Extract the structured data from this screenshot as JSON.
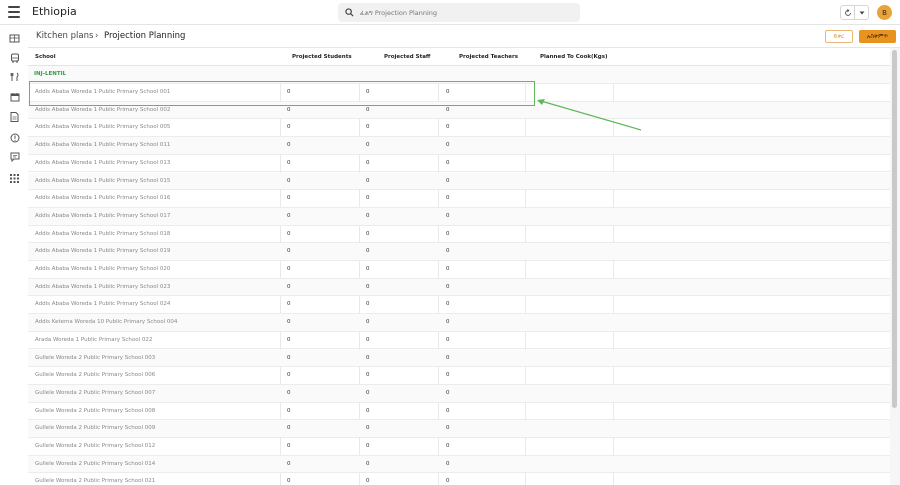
{
  "app": {
    "title": "Ethiopia",
    "avatar_initial": "B"
  },
  "search": {
    "placeholder": "ፈልግ Projection Planning"
  },
  "breadcrumb": {
    "root": "Kitchen plans",
    "separator": "›",
    "current": "Projection Planning"
  },
  "actions": {
    "edit_label": "ይቀር",
    "submit_label": "አስቀምጥ"
  },
  "sidebar": {
    "icons": [
      "kitchen-icon",
      "bus-icon",
      "fork-knife-icon",
      "calendar-icon",
      "document-icon",
      "info-icon",
      "chat-icon",
      "apps-grid-icon"
    ]
  },
  "table": {
    "columns": [
      "School",
      "Projected Students",
      "Projected Staff",
      "Projected Teachers",
      "Planned To Cook(Kgs)"
    ],
    "group": "INJ-LENTIL",
    "rows": [
      {
        "school": "Addis Ababa Woreda 1 Public Primary School 001",
        "students": "0",
        "staff": "0",
        "teachers": "0"
      },
      {
        "school": "Addis Ababa Woreda 1 Public Primary School 002",
        "students": "0",
        "staff": "0",
        "teachers": "0"
      },
      {
        "school": "Addis Ababa Woreda 1 Public Primary School 005",
        "students": "0",
        "staff": "0",
        "teachers": "0"
      },
      {
        "school": "Addis Ababa Woreda 1 Public Primary School 011",
        "students": "0",
        "staff": "0",
        "teachers": "0"
      },
      {
        "school": "Addis Ababa Woreda 1 Public Primary School 013",
        "students": "0",
        "staff": "0",
        "teachers": "0"
      },
      {
        "school": "Addis Ababa Woreda 1 Public Primary School 015",
        "students": "0",
        "staff": "0",
        "teachers": "0"
      },
      {
        "school": "Addis Ababa Woreda 1 Public Primary School 016",
        "students": "0",
        "staff": "0",
        "teachers": "0"
      },
      {
        "school": "Addis Ababa Woreda 1 Public Primary School 017",
        "students": "0",
        "staff": "0",
        "teachers": "0"
      },
      {
        "school": "Addis Ababa Woreda 1 Public Primary School 018",
        "students": "0",
        "staff": "0",
        "teachers": "0"
      },
      {
        "school": "Addis Ababa Woreda 1 Public Primary School 019",
        "students": "0",
        "staff": "0",
        "teachers": "0"
      },
      {
        "school": "Addis Ababa Woreda 1 Public Primary School 020",
        "students": "0",
        "staff": "0",
        "teachers": "0"
      },
      {
        "school": "Addis Ababa Woreda 1 Public Primary School 023",
        "students": "0",
        "staff": "0",
        "teachers": "0"
      },
      {
        "school": "Addis Ababa Woreda 1 Public Primary School 024",
        "students": "0",
        "staff": "0",
        "teachers": "0"
      },
      {
        "school": "Addis Ketema Woreda 10 Public Primary School 004",
        "students": "0",
        "staff": "0",
        "teachers": "0"
      },
      {
        "school": "Arada Woreda 1 Public Primary School 022",
        "students": "0",
        "staff": "0",
        "teachers": "0"
      },
      {
        "school": "Gullele Woreda 2 Public Primary School 003",
        "students": "0",
        "staff": "0",
        "teachers": "0"
      },
      {
        "school": "Gullele Woreda 2 Public Primary School 006",
        "students": "0",
        "staff": "0",
        "teachers": "0"
      },
      {
        "school": "Gullele Woreda 2 Public Primary School 007",
        "students": "0",
        "staff": "0",
        "teachers": "0"
      },
      {
        "school": "Gullele Woreda 2 Public Primary School 008",
        "students": "0",
        "staff": "0",
        "teachers": "0"
      },
      {
        "school": "Gullele Woreda 2 Public Primary School 009",
        "students": "0",
        "staff": "0",
        "teachers": "0"
      },
      {
        "school": "Gullele Woreda 2 Public Primary School 012",
        "students": "0",
        "staff": "0",
        "teachers": "0"
      },
      {
        "school": "Gullele Woreda 2 Public Primary School 014",
        "students": "0",
        "staff": "0",
        "teachers": "0"
      },
      {
        "school": "Gullele Woreda 2 Public Primary School 021",
        "students": "0",
        "staff": "0",
        "teachers": "0"
      }
    ]
  },
  "colors": {
    "accent": "#e8921f",
    "group_label": "#2e9e3e",
    "highlight": "#5fb95a"
  }
}
